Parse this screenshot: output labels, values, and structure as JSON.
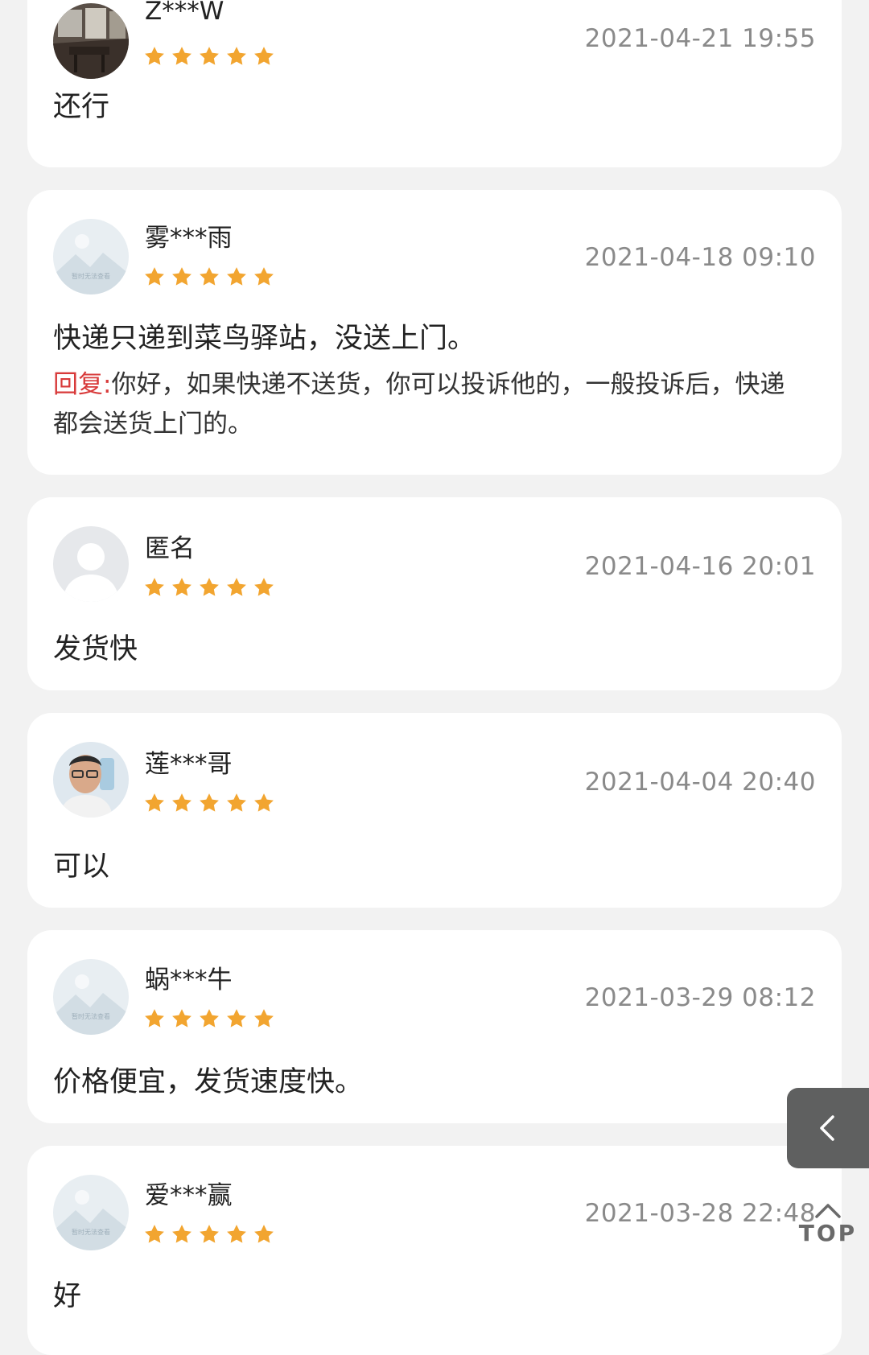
{
  "reviews": [
    {
      "user": "Z***W",
      "time": "2021-04-21 19:55",
      "rating": 5,
      "content": "还行",
      "avatar": "photo-interior"
    },
    {
      "user": "雾***雨",
      "time": "2021-04-18 09:10",
      "rating": 5,
      "content": "快递只递到菜鸟驿站，没送上门。",
      "avatar": "placeholder",
      "reply_label": "回复:",
      "reply": "你好，如果快递不送货，你可以投诉他的，一般投诉后，快递都会送货上门的。"
    },
    {
      "user": "匿名",
      "time": "2021-04-16 20:01",
      "rating": 5,
      "content": "发货快",
      "avatar": "anonymous"
    },
    {
      "user": "莲***哥",
      "time": "2021-04-04 20:40",
      "rating": 5,
      "content": "可以",
      "avatar": "photo-person"
    },
    {
      "user": "蜗***牛",
      "time": "2021-03-29 08:12",
      "rating": 5,
      "content": "价格便宜，发货速度快。",
      "avatar": "placeholder"
    },
    {
      "user": "爱***赢",
      "time": "2021-03-28 22:48",
      "rating": 5,
      "content": "好",
      "avatar": "placeholder"
    }
  ],
  "placeholder_caption": "暂时无法查看",
  "back_button": {
    "icon": "chevron-left-icon"
  },
  "top_button": {
    "label": "TOP",
    "icon": "chevron-up-icon"
  },
  "colors": {
    "star": "#f2a530",
    "reply_label": "#d83a3a",
    "time": "#8a8a8a",
    "background": "#f2f2f2"
  }
}
